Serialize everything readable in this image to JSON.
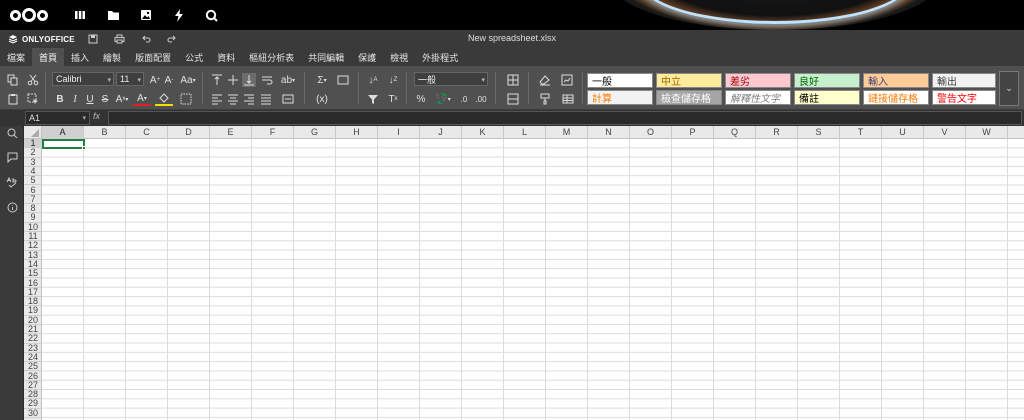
{
  "nextcloud": {
    "apps": [
      {
        "name": "dashboard-icon"
      },
      {
        "name": "files-icon"
      },
      {
        "name": "photos-icon"
      },
      {
        "name": "activity-icon"
      },
      {
        "name": "search-icon"
      }
    ]
  },
  "app": {
    "brand": "ONLYOFFICE",
    "filename": "New spreadsheet.xlsx"
  },
  "menu_tabs": [
    "檔案",
    "首頁",
    "插入",
    "繪製",
    "版面配置",
    "公式",
    "資料",
    "樞紐分析表",
    "共同編輯",
    "保護",
    "檢視",
    "外掛程式"
  ],
  "active_tab": "首頁",
  "toolbar": {
    "font_name": "Calibri",
    "font_size": "11",
    "number_format": "一般",
    "styles": [
      {
        "label": "一般",
        "bg": "#ffffff",
        "color": "#000000"
      },
      {
        "label": "中立",
        "bg": "#ffeb9c",
        "color": "#9c6500"
      },
      {
        "label": "差劣",
        "bg": "#ffc7ce",
        "color": "#9c0006"
      },
      {
        "label": "良好",
        "bg": "#c6efce",
        "color": "#006100"
      },
      {
        "label": "輸入",
        "bg": "#ffcc99",
        "color": "#3f3f76"
      },
      {
        "label": "輸出",
        "bg": "#f2f2f2",
        "color": "#3f3f3f"
      },
      {
        "label": "計算",
        "bg": "#f2f2f2",
        "color": "#fa7d00"
      },
      {
        "label": "檢查儲存格",
        "bg": "#a5a5a5",
        "color": "#ffffff"
      },
      {
        "label": "解釋性文字",
        "bg": "#ffffff",
        "color": "#7f7f7f"
      },
      {
        "label": "備註",
        "bg": "#ffffcc",
        "color": "#000000"
      },
      {
        "label": "鏈接儲存格",
        "bg": "#ffffff",
        "color": "#fa7d00"
      },
      {
        "label": "警告文字",
        "bg": "#ffffff",
        "color": "#ff0000"
      }
    ]
  },
  "formula_bar": {
    "name_box": "A1",
    "fx": "fx",
    "value": ""
  },
  "sheet": {
    "columns": [
      "A",
      "B",
      "C",
      "D",
      "E",
      "F",
      "G",
      "H",
      "I",
      "J",
      "K",
      "L",
      "M",
      "N",
      "O",
      "P",
      "Q",
      "R",
      "S",
      "T",
      "U",
      "V",
      "W"
    ],
    "rows": [
      "1",
      "2",
      "3",
      "4",
      "5",
      "6",
      "7",
      "8",
      "9",
      "10",
      "11",
      "12",
      "13",
      "14",
      "15",
      "16",
      "17",
      "18",
      "19",
      "20",
      "21",
      "22",
      "23",
      "24",
      "25",
      "26",
      "27",
      "28",
      "29",
      "30"
    ],
    "active_cell": "A1"
  },
  "colors": {
    "accent": "#1e7e44",
    "toolbar": "#505050"
  }
}
